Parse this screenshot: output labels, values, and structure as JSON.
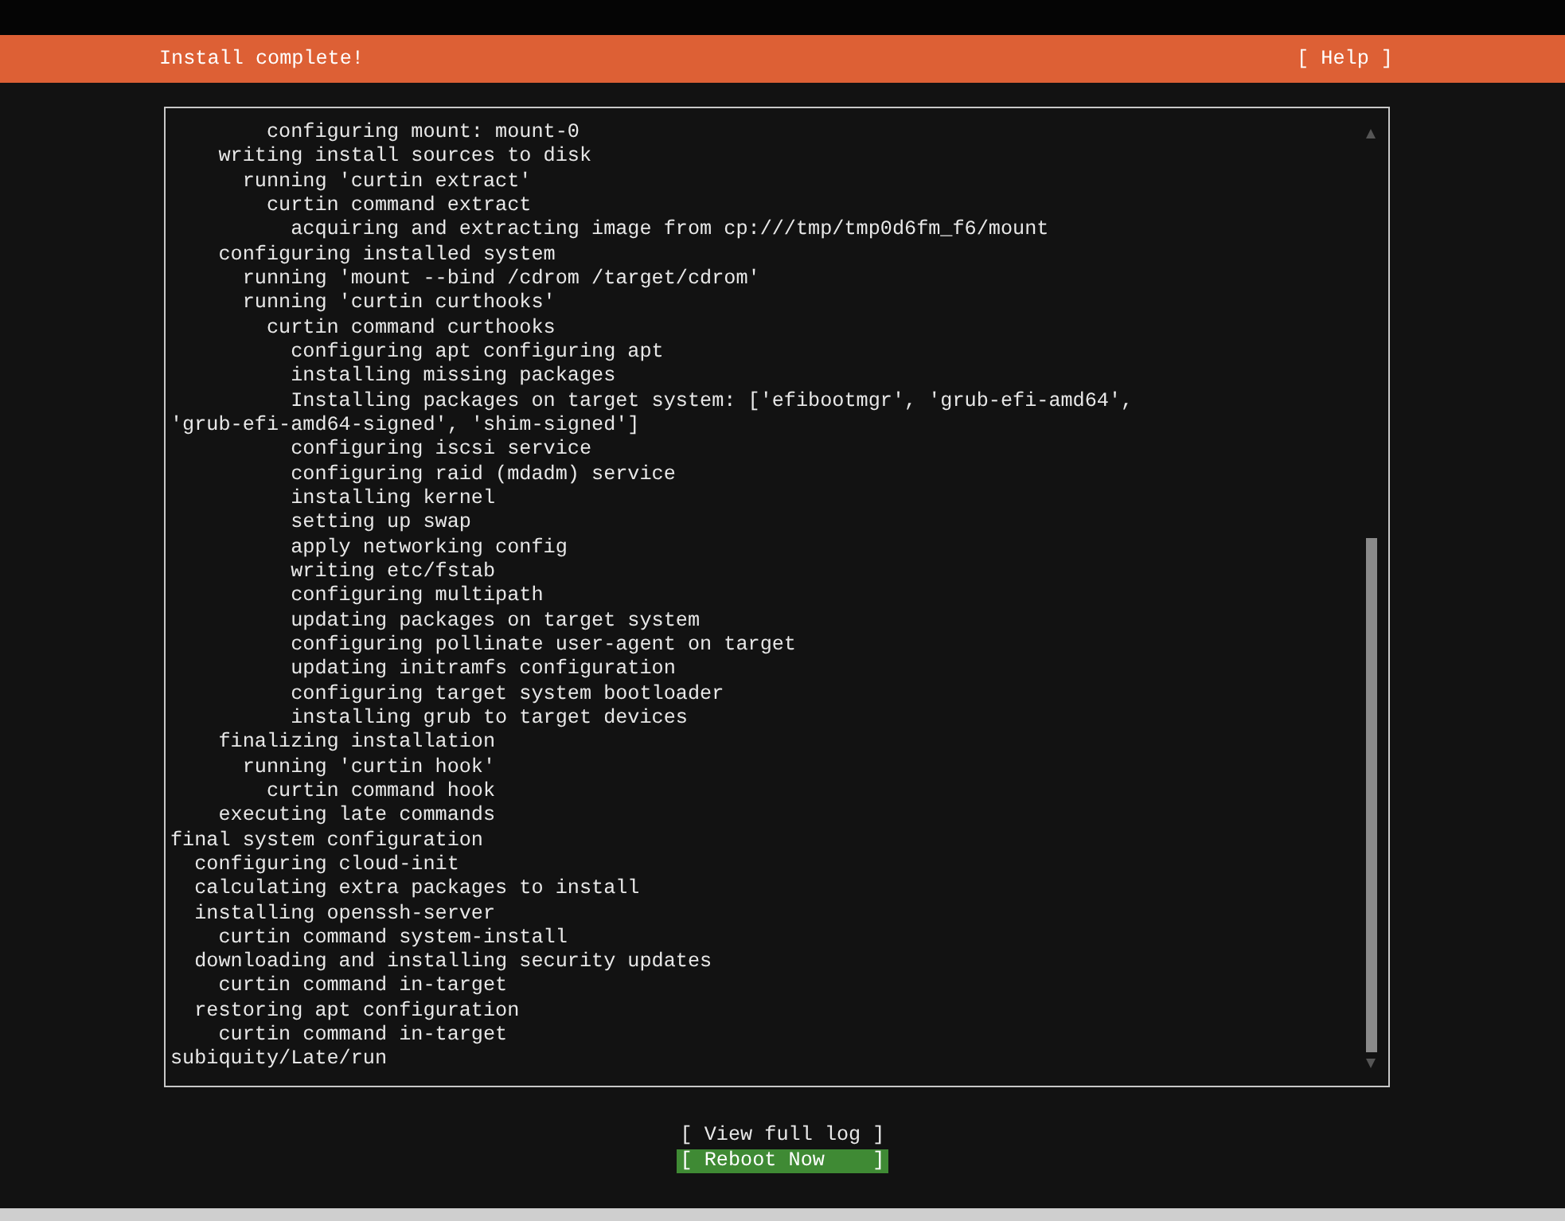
{
  "header": {
    "title": "Install complete!",
    "help": "[ Help ]"
  },
  "log": {
    "lines": [
      "        configuring mount: mount-0",
      "    writing install sources to disk",
      "      running 'curtin extract'",
      "        curtin command extract",
      "          acquiring and extracting image from cp:///tmp/tmp0d6fm_f6/mount",
      "    configuring installed system",
      "      running 'mount --bind /cdrom /target/cdrom'",
      "      running 'curtin curthooks'",
      "        curtin command curthooks",
      "          configuring apt configuring apt",
      "          installing missing packages",
      "          Installing packages on target system: ['efibootmgr', 'grub-efi-amd64',",
      "'grub-efi-amd64-signed', 'shim-signed']",
      "          configuring iscsi service",
      "          configuring raid (mdadm) service",
      "          installing kernel",
      "          setting up swap",
      "          apply networking config",
      "          writing etc/fstab",
      "          configuring multipath",
      "          updating packages on target system",
      "          configuring pollinate user-agent on target",
      "          updating initramfs configuration",
      "          configuring target system bootloader",
      "          installing grub to target devices",
      "    finalizing installation",
      "      running 'curtin hook'",
      "        curtin command hook",
      "    executing late commands",
      "final system configuration",
      "  configuring cloud-init",
      "  calculating extra packages to install",
      "  installing openssh-server",
      "    curtin command system-install",
      "  downloading and installing security updates",
      "    curtin command in-target",
      "  restoring apt configuration",
      "    curtin command in-target",
      "subiquity/Late/run"
    ]
  },
  "buttons": [
    {
      "label": "[ View full log ]",
      "selected": false
    },
    {
      "label": "[ Reboot Now    ]",
      "selected": true
    }
  ]
}
